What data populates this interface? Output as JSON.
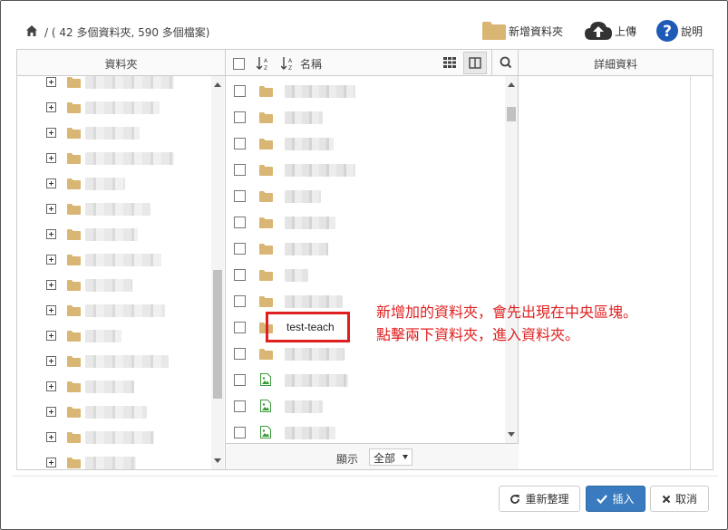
{
  "toolbar": {
    "path_text": "/ ( 42 多個資料夾, 590 多個檔案)",
    "new_folder_label": "新增資料夾",
    "upload_label": "上傳",
    "help_label": "說明"
  },
  "left_pane": {
    "title": "資料夾"
  },
  "middle_pane": {
    "name_header": "名稱",
    "new_folder_name": "test-teach",
    "footer_show_label": "顯示",
    "footer_select_value": "全部"
  },
  "right_pane": {
    "title": "詳細資料"
  },
  "annotation": {
    "line1": "新增加的資料夾，會先出現在中央區塊。",
    "line2": "點擊兩下資料夾，進入資料夾。"
  },
  "buttons": {
    "refresh_label": "重新整理",
    "insert_label": "插入",
    "cancel_label": "取消"
  },
  "colors": {
    "folder": "#d9b673",
    "image_icon": "#3c9a3c",
    "primary": "#3a7bbf",
    "annotation": "#e02020",
    "help_icon": "#1d5bb6"
  }
}
